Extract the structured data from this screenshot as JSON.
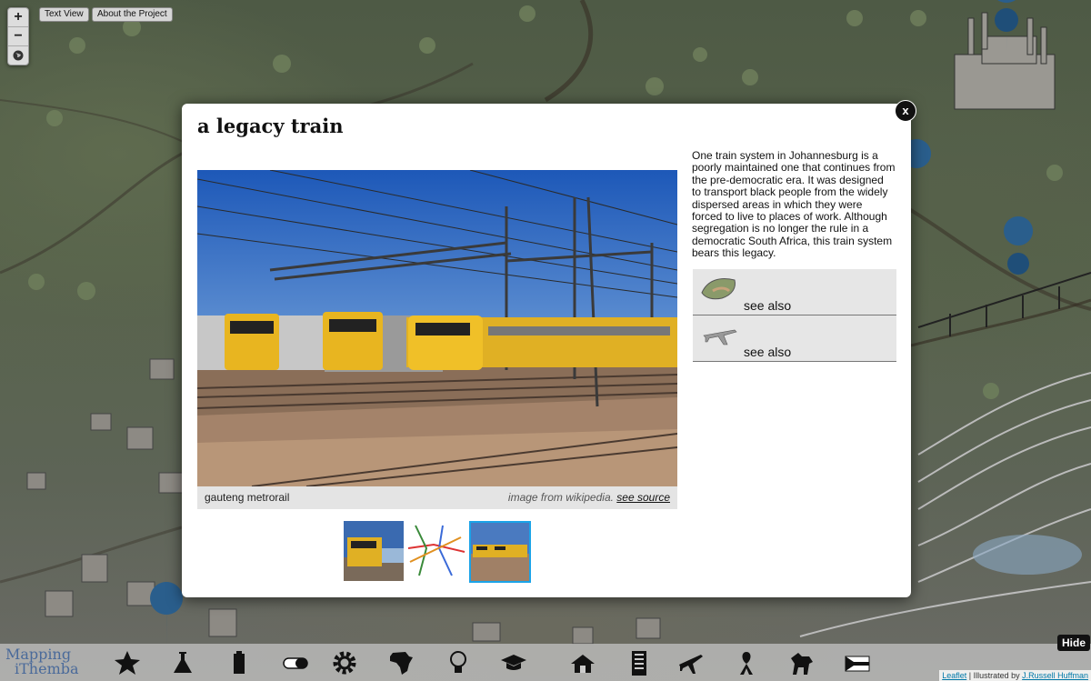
{
  "map": {
    "zoom_in_label": "+",
    "zoom_out_label": "−",
    "text_view_label": "Text View",
    "about_label": "About the Project"
  },
  "modal": {
    "title": "a legacy train",
    "close_label": "x",
    "image_caption": "gauteng metrorail",
    "image_source_prefix": "image from wikipedia.",
    "image_source_link": "see source",
    "description": "One train system in Johannesburg is a poorly maintained one that continues from the pre-democratic era. It was designed to transport black people from the widely dispersed areas in which they were forced to live to places of work. Although segregation is no longer the rule in a democratic South Africa, this train system bears this legacy.",
    "see_also": [
      {
        "label": "see also",
        "icon": "landscape-icon"
      },
      {
        "label": "see also",
        "icon": "airplane-icon"
      }
    ],
    "thumbnails": [
      {
        "icon": "train-photo-thumb"
      },
      {
        "icon": "rail-map-thumb"
      },
      {
        "icon": "train-yard-thumb",
        "selected": true
      }
    ]
  },
  "bottom_bar": {
    "logo_line1": "Mapping",
    "logo_line2": "iThemba",
    "icons": [
      "star-icon",
      "flask-icon",
      "battery-icon",
      "pill-icon",
      "gear-icon",
      "africa-icon",
      "lightbulb-icon",
      "graduation-cap-icon",
      "house-icon",
      "building-icon",
      "airplane-icon",
      "ribbon-icon",
      "horse-icon",
      "flag-icon"
    ],
    "hide_label": "Hide"
  },
  "attribution": {
    "leaflet": "Leaflet",
    "separator": " | Illustrated by ",
    "illustrator": "J.Russell Huffman"
  },
  "colors": {
    "selected_border": "#1aa3e8",
    "modal_bg": "#ffffff"
  }
}
